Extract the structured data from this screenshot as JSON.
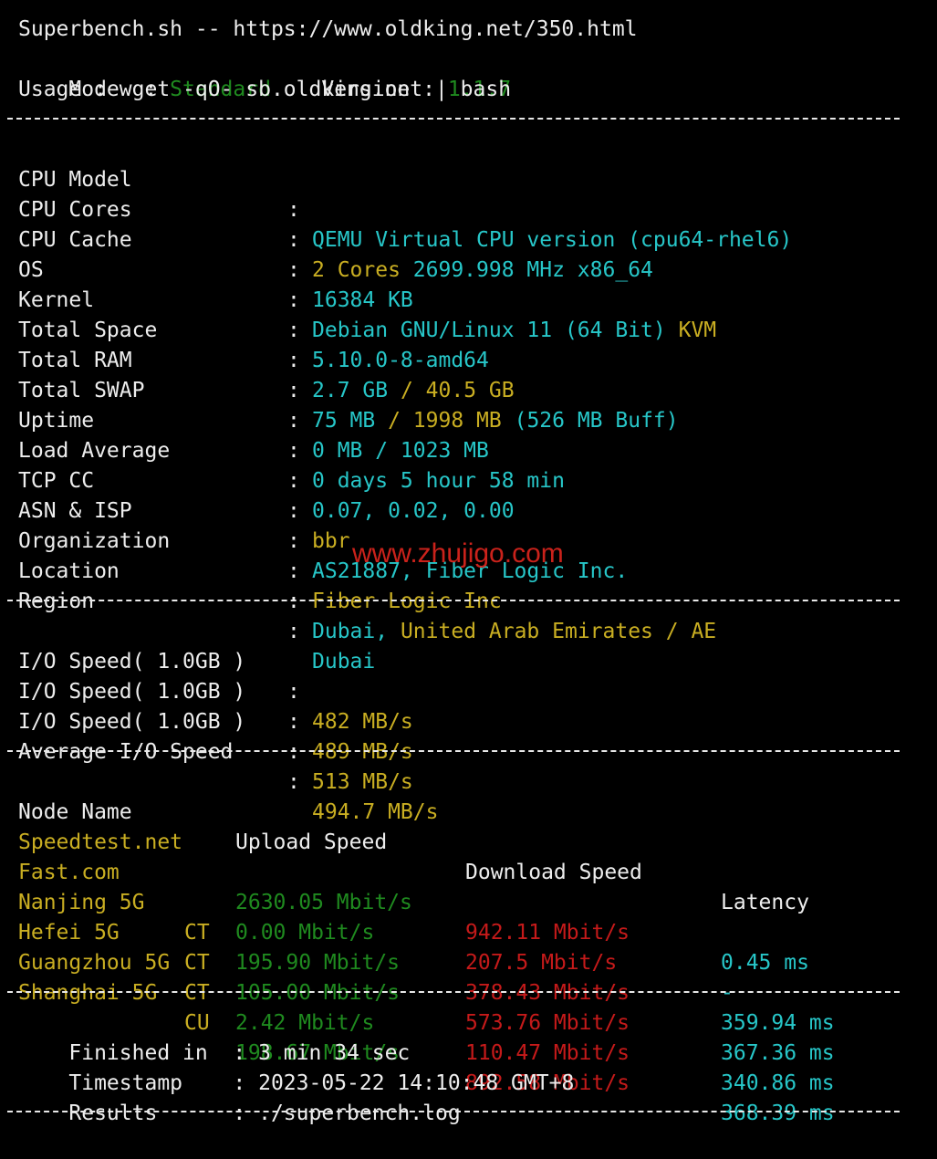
{
  "header": {
    "title_line": "Superbench.sh -- https://www.oldking.net/350.html",
    "mode_label": "Mode  : ",
    "mode_value": "Standard",
    "version_label": "Version : ",
    "version_value": "1.1.7",
    "usage_line": "Usage : wget -qO- sb.oldking.net | bash"
  },
  "system": {
    "rows": [
      {
        "key": "CPU Model",
        "value": "QEMU Virtual CPU version (cpu64-rhel6)"
      },
      {
        "key": "CPU Cores",
        "value_a": "2 Cores",
        "value_b": "2699.998 MHz x86_64"
      },
      {
        "key": "CPU Cache",
        "value": "16384 KB"
      },
      {
        "key": "OS",
        "value_a": "Debian GNU/Linux 11 (64 Bit)",
        "value_b": "KVM"
      },
      {
        "key": "Kernel",
        "value": "5.10.0-8-amd64"
      },
      {
        "key": "Total Space",
        "value_a": "2.7 GB",
        "value_b": "/ 40.5 GB"
      },
      {
        "key": "Total RAM",
        "value_a": "75 MB",
        "value_b": "/ 1998 MB",
        "value_c": "(526 MB Buff)"
      },
      {
        "key": "Total SWAP",
        "value": "0 MB / 1023 MB"
      },
      {
        "key": "Uptime",
        "value": "0 days 5 hour 58 min"
      },
      {
        "key": "Load Average",
        "value": "0.07, 0.02, 0.00"
      },
      {
        "key": "TCP CC",
        "value": "bbr"
      },
      {
        "key": "ASN & ISP",
        "value": "AS21887, Fiber Logic Inc."
      },
      {
        "key": "Organization",
        "value": "Fiber Logic Inc"
      },
      {
        "key": "Location",
        "value_a": "Dubai,",
        "value_b": "United Arab Emirates",
        "value_c": "/ AE"
      },
      {
        "key": "Region",
        "value": "Dubai"
      }
    ]
  },
  "io": {
    "rows": [
      {
        "key": "I/O Speed( 1.0GB )",
        "value": "482 MB/s"
      },
      {
        "key": "I/O Speed( 1.0GB )",
        "value": "489 MB/s"
      },
      {
        "key": "I/O Speed( 1.0GB )",
        "value": "513 MB/s"
      },
      {
        "key": "Average I/O Speed",
        "value": "494.7 MB/s"
      }
    ]
  },
  "speedtest": {
    "headers": {
      "node": "Node Name",
      "upload": "Upload Speed",
      "download": "Download Speed",
      "latency": "Latency"
    },
    "rows": [
      {
        "node": "Speedtest.net",
        "tag": "",
        "upload": "2630.05 Mbit/s",
        "download": "942.11 Mbit/s",
        "latency": "0.45 ms"
      },
      {
        "node": "Fast.com",
        "tag": "",
        "upload": "0.00 Mbit/s",
        "download": "207.5 Mbit/s",
        "latency": "-"
      },
      {
        "node": "Nanjing 5G",
        "tag": "CT",
        "upload": "195.90 Mbit/s",
        "download": "378.43 Mbit/s",
        "latency": "359.94 ms"
      },
      {
        "node": "Hefei 5G",
        "tag": "CT",
        "upload": "105.00 Mbit/s",
        "download": "573.76 Mbit/s",
        "latency": "367.36 ms"
      },
      {
        "node": "Guangzhou 5G",
        "tag": "CT",
        "upload": "2.42 Mbit/s",
        "download": "110.47 Mbit/s",
        "latency": "340.86 ms"
      },
      {
        "node": "Shanghai 5G",
        "tag": "CU",
        "upload": "198.67 Mbit/s",
        "download": "892.58 Mbit/s",
        "latency": "368.39 ms"
      }
    ]
  },
  "footer": {
    "finished_label": "Finished in  : ",
    "finished_value": "3 min 34 sec",
    "timestamp_label": "Timestamp    : ",
    "timestamp_value": "2023-05-22 14:10:48 GMT+8",
    "results_label": "Results      : ",
    "results_value": "./superbench.log"
  },
  "watermark": "www.zhujigo.com",
  "colors": {
    "background": "#000000",
    "text": "#ededed",
    "green": "#1f8a1f",
    "cyan": "#27c6c8",
    "yellow": "#c9ae22",
    "red": "#c51a1a"
  }
}
